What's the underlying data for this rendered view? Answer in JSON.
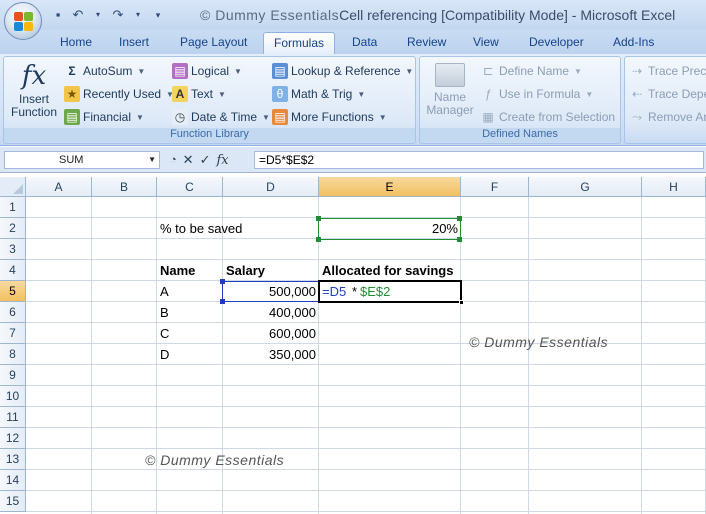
{
  "title_bar": {
    "watermark": "© Dummy Essentials",
    "title": "Cell referencing  [Compatibility Mode] - Microsoft Excel"
  },
  "tabs": [
    "Home",
    "Insert",
    "Page Layout",
    "Formulas",
    "Data",
    "Review",
    "View",
    "Developer",
    "Add-Ins"
  ],
  "active_tab": "Formulas",
  "ribbon": {
    "function_library": {
      "label": "Function Library",
      "insert_function": "Insert Function",
      "autosum": "AutoSum",
      "recently_used": "Recently Used",
      "financial": "Financial",
      "logical": "Logical",
      "text": "Text",
      "date_time": "Date & Time",
      "lookup_reference": "Lookup & Reference",
      "math_trig": "Math & Trig",
      "more_functions": "More Functions"
    },
    "defined_names": {
      "label": "Defined Names",
      "name_manager": "Name Manager",
      "define_name": "Define Name",
      "use_in_formula": "Use in Formula",
      "create_from_selection": "Create from Selection"
    },
    "formula_auditing": {
      "trace_precedents": "Trace Prece",
      "trace_dependents": "Trace Depe",
      "remove_arrows": "Remove Ar"
    }
  },
  "formula_bar": {
    "name_box": "SUM",
    "formula": "=D5*$E$2"
  },
  "grid": {
    "columns": [
      "A",
      "B",
      "C",
      "D",
      "E",
      "F",
      "G",
      "H"
    ],
    "rows": [
      "1",
      "2",
      "3",
      "4",
      "5",
      "6",
      "7",
      "8",
      "9",
      "10",
      "11",
      "12",
      "13",
      "14",
      "15"
    ],
    "selected_column": "E",
    "selected_row": "5",
    "cells": {
      "C2": "% to be saved",
      "E2": "20%",
      "C4": "Name",
      "D4": "Salary",
      "E4": "Allocated for savings",
      "C5": "A",
      "D5": "500,000",
      "E5_ref1": "=D5",
      "E5_op": "*",
      "E5_ref2": "$E$2",
      "C6": "B",
      "D6": "400,000",
      "C7": "C",
      "D7": "600,000",
      "C8": "D",
      "D8": "350,000"
    },
    "watermark_1": "© Dummy Essentials",
    "watermark_2": "© Dummy Essentials"
  },
  "colors": {
    "ref_blue": "#1f3fbf",
    "ref_green": "#1f8f2f",
    "selection": "#000000"
  }
}
